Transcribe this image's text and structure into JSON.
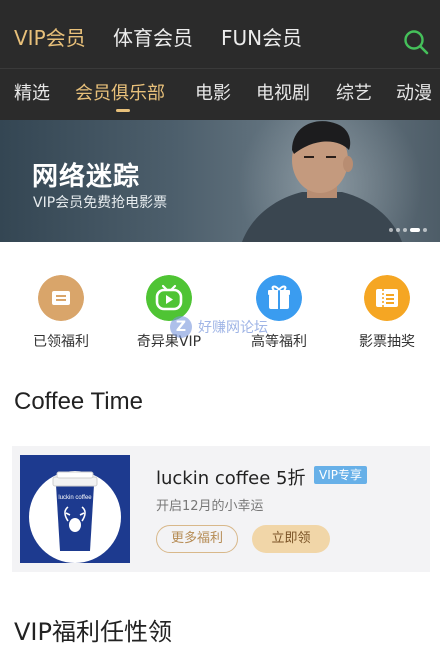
{
  "header": {
    "tabs": [
      {
        "label": "VIP会员",
        "active": true
      },
      {
        "label": "体育会员",
        "active": false
      },
      {
        "label": "FUN会员",
        "active": false
      }
    ],
    "search_icon": "search-icon",
    "accent_color": "#e8c07a",
    "search_color": "#45c05a"
  },
  "categories": {
    "tabs": [
      {
        "label": "精选",
        "active": false
      },
      {
        "label": "会员俱乐部",
        "active": true
      },
      {
        "label": "电影",
        "active": false
      },
      {
        "label": "电视剧",
        "active": false
      },
      {
        "label": "综艺",
        "active": false
      },
      {
        "label": "动漫",
        "active": false
      }
    ]
  },
  "banner": {
    "title": "网络迷踪",
    "subtitle": "VIP会员免费抢电影票"
  },
  "benefits": [
    {
      "label": "已领福利",
      "icon": "ticket-icon",
      "color": "#d9a56a"
    },
    {
      "label": "奇异果VIP",
      "icon": "tv-icon",
      "color": "#4fc434"
    },
    {
      "label": "高等福利",
      "icon": "gift-icon",
      "color": "#3a9cf0"
    },
    {
      "label": "影票抽奖",
      "icon": "lottery-ticket-icon",
      "color": "#f5a623"
    }
  ],
  "watermark": {
    "text": "好赚网论坛",
    "badge": "Z"
  },
  "coffee_section": {
    "title": "Coffee Time",
    "card": {
      "title": "luckin coffee 5折",
      "tag": "VIP专享",
      "subtitle": "开启12月的小幸运",
      "more_button": "更多福利",
      "claim_button": "立即领",
      "image_text": "luckin coffee"
    }
  },
  "vip_section": {
    "title": "VIP福利任性领"
  }
}
